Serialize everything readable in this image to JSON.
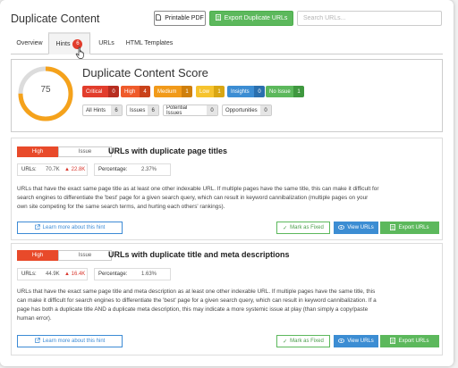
{
  "header": {
    "title": "Duplicate Content",
    "printable_pdf": "Printable PDF",
    "export_button": "Export Duplicate URLs",
    "search_placeholder": "Search URLs..."
  },
  "tabs": [
    {
      "label": "Overview"
    },
    {
      "label": "Hints",
      "badge": "6"
    },
    {
      "label": "URLs"
    },
    {
      "label": "HTML Templates"
    }
  ],
  "score": {
    "heading": "Duplicate Content Score",
    "value": "75",
    "gauge_fraction": 0.75,
    "levels": [
      {
        "label": "Critical",
        "count": "0",
        "color": "#e23d2c",
        "count_color": "#b72d20"
      },
      {
        "label": "High",
        "count": "4",
        "color": "#ef5b2b",
        "count_color": "#c9421a"
      },
      {
        "label": "Medium",
        "count": "1",
        "color": "#f19a1a",
        "count_color": "#cf7f0c"
      },
      {
        "label": "Low",
        "count": "1",
        "color": "#f6c32e",
        "count_color": "#d9a612"
      },
      {
        "label": "Insights",
        "count": "0",
        "color": "#3c8dd3",
        "count_color": "#2a6fae"
      },
      {
        "label": "No Issue",
        "count": "1",
        "color": "#5cb85c",
        "count_color": "#3f983f"
      }
    ],
    "counts": [
      {
        "label": "All Hints",
        "count": "6"
      },
      {
        "label": "Issues",
        "count": "6"
      },
      {
        "label": "Potential Issues",
        "count": "0"
      },
      {
        "label": "Opportunities",
        "count": "0"
      }
    ]
  },
  "hints": [
    {
      "priority": "High",
      "type": "Issue",
      "title": "URLs with duplicate page titles",
      "urls_label": "URLs:",
      "urls_value": "70.7K",
      "urls_delta": "▲ 22.8K",
      "percentage_label": "Percentage:",
      "percentage_value": "2.37%",
      "description_lines": [
        "URLs that have the exact same page title as at least one other indexable URL. If multiple pages have the same title, this can make it difficult for",
        "search engines to differentiate the 'best' page for a given search query, which can result in keyword cannibalization (multiple pages on your",
        "own site competing for the same search terms, and hurting each others' rankings)."
      ],
      "learn_more": "Learn more about this hint",
      "mark_fixed": "Mark as Fixed",
      "view_urls": "View URLs",
      "export_urls": "Export URLs"
    },
    {
      "priority": "High",
      "type": "Issue",
      "title": "URLs with duplicate title and meta descriptions",
      "urls_label": "URLs:",
      "urls_value": "44.9K",
      "urls_delta": "▲ 16.4K",
      "percentage_label": "Percentage:",
      "percentage_value": "1.63%",
      "description_lines": [
        "URLs that have the exact same page title and meta description as at least one other indexable URL. If multiple pages have the same title, this",
        "can make it difficult for search engines to differentiate the 'best' page for a given search query, which can result in keyword cannibalization. If a",
        "page has both a duplicate title AND a duplicate meta description, this may indicate a more systemic issue at play (than simply a copy/paste",
        "human error)."
      ],
      "learn_more": "Learn more about this hint",
      "mark_fixed": "Mark as Fixed",
      "view_urls": "View URLs",
      "export_urls": "Export URLs"
    }
  ],
  "colors": {
    "green": "#5cb85c",
    "blue": "#3c8dd3",
    "high": "#e84a2a",
    "gauge": "#f5a21b",
    "gauge_track": "#dcdcdc"
  }
}
